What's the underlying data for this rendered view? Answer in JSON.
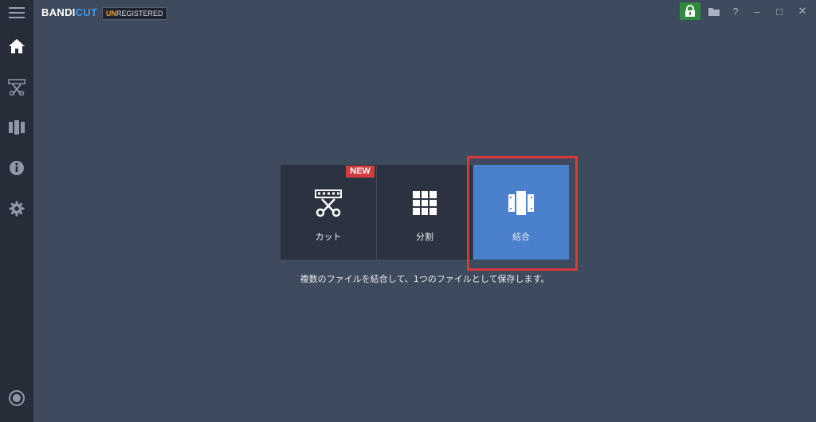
{
  "app": {
    "logo_main": "BANDI",
    "logo_cut": "CUT",
    "badge_un": "UN",
    "badge_rest": "REGISTERED"
  },
  "titlebar": {
    "help": "?",
    "minimize": "‒",
    "maximize": "□",
    "close": "✕"
  },
  "sidebar": {
    "items": [
      {
        "icon": "home-icon"
      },
      {
        "icon": "cut-tool-icon"
      },
      {
        "icon": "film-icon"
      },
      {
        "icon": "info-icon"
      },
      {
        "icon": "gear-icon"
      },
      {
        "icon": "record-icon"
      }
    ]
  },
  "modes": {
    "cut_label": "カット",
    "new_badge": "NEW",
    "split_label": "分割",
    "join_label": "結合"
  },
  "description": "複数のファイルを結合して、1つのファイルとして保存します。",
  "colors": {
    "background": "#3e4a5e",
    "sidebar": "#262d39",
    "tile": "#2b3341",
    "active_tile": "#4a80cc",
    "highlight": "#d9383c",
    "new_badge": "#d23c3c",
    "lock_button": "#2f8a3e",
    "logo_accent": "#3a9af0"
  }
}
